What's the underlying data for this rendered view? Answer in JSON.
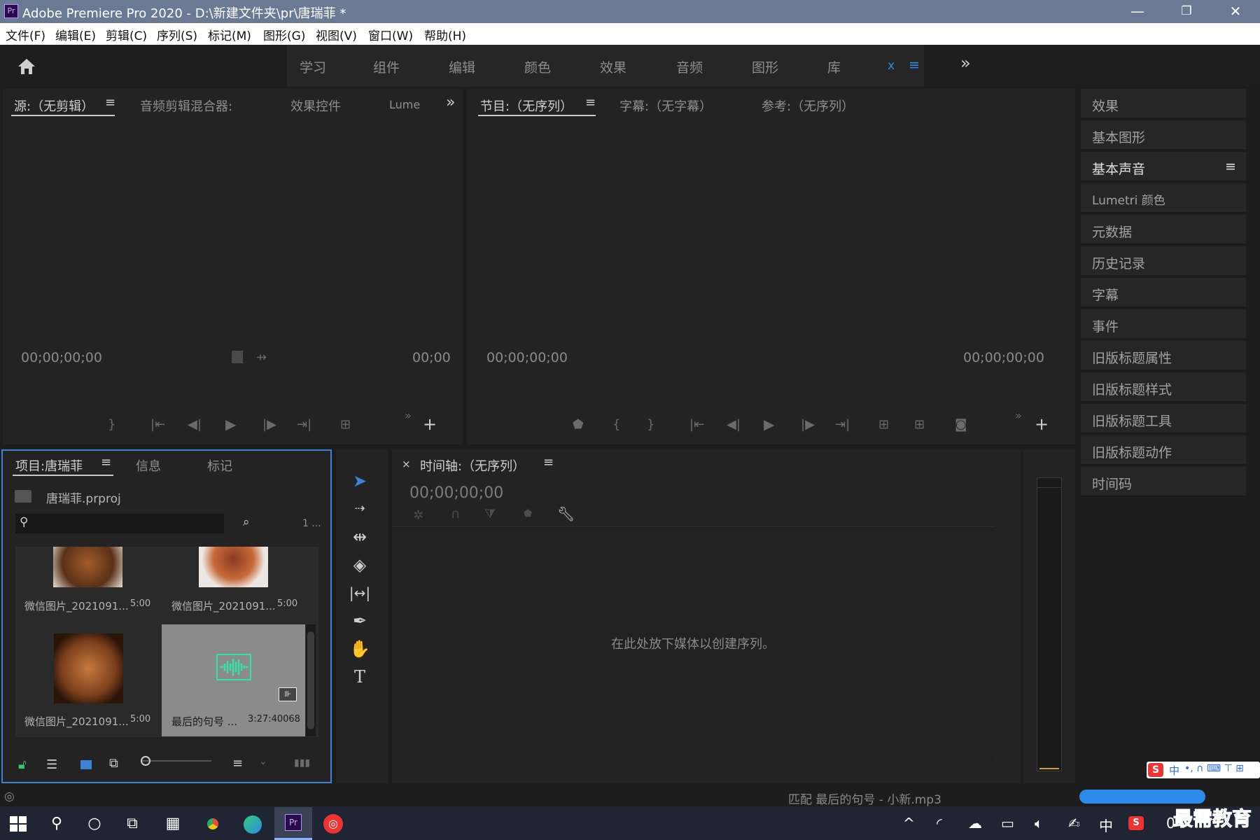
{
  "window": {
    "app_icon": "Pr",
    "title": "Adobe Premiere Pro 2020 - D:\\新建文件夹\\pr\\唐瑞菲 *",
    "controls": [
      "—",
      "❐",
      "✕"
    ]
  },
  "menu": [
    "文件(F)",
    "编辑(E)",
    "剪辑(C)",
    "序列(S)",
    "标记(M)",
    "图形(G)",
    "视图(V)",
    "窗口(W)",
    "帮助(H)"
  ],
  "workspaces": {
    "tabs": [
      "学习",
      "组件",
      "编辑",
      "颜色",
      "效果",
      "音频",
      "图形",
      "库"
    ],
    "close": "x",
    "menu": "≡",
    "more": "»"
  },
  "source_panel": {
    "tabs": [
      "源:（无剪辑）",
      "音频剪辑混合器:",
      "效果控件",
      "Lume"
    ],
    "timecode_left": "00;00;00;00",
    "timecode_right": "00;00"
  },
  "program_panel": {
    "tabs": [
      "节目:（无序列）",
      "字幕:（无字幕）",
      "参考:（无序列）"
    ],
    "timecode_left": "00;00;00;00",
    "timecode_right": "00;00;00;00"
  },
  "right_panel": {
    "items": [
      "效果",
      "基本图形",
      "基本声音",
      "Lumetri 颜色",
      "元数据",
      "历史记录",
      "字幕",
      "事件",
      "旧版标题属性",
      "旧版标题样式",
      "旧版标题工具",
      "旧版标题动作",
      "时间码"
    ],
    "active_index": 2
  },
  "project_panel": {
    "tabs": [
      "项目:唐瑞菲",
      "信息",
      "标记"
    ],
    "file": "唐瑞菲.prproj",
    "search_placeholder": "",
    "count": "1 ...",
    "items": [
      {
        "name": "微信图片_2021091...",
        "duration": "5:00"
      },
      {
        "name": "微信图片_2021091...",
        "duration": "5:00"
      },
      {
        "name": "微信图片_2021091...",
        "duration": "5:00"
      },
      {
        "name": "最后的句号 ...",
        "duration": "3:27:40068"
      }
    ]
  },
  "timeline_panel": {
    "close": "×",
    "title": "时间轴:（无序列）",
    "timecode": "00;00;00;00",
    "empty_hint": "在此处放下媒体以创建序列。"
  },
  "status_bar": {
    "text": "匹配 最后的句号 - 小新.mp3"
  },
  "ime": {
    "label": "中"
  },
  "watermark": "最需教育",
  "taskbar": {
    "tray_text": "中",
    "time_partial": "0"
  },
  "colors": {
    "accent_blue": "#2d8ceb",
    "title_bar": "#6a7a94",
    "selection_blue": "#3c82d6",
    "waveform_green": "#2ee6a6"
  }
}
